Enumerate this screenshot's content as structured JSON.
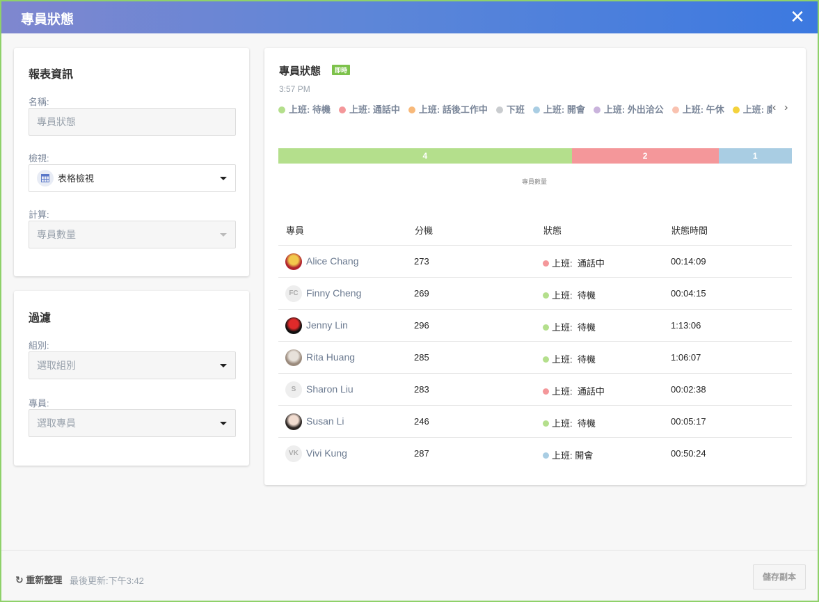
{
  "window": {
    "title": "專員狀態",
    "close_icon": "close-icon"
  },
  "left": {
    "report": {
      "title": "報表資訊",
      "name_label": "名稱:",
      "name_placeholder": "專員狀態",
      "view_label": "檢視:",
      "view_value": "表格檢視",
      "calc_label": "計算:",
      "calc_value": "專員數量"
    },
    "filter": {
      "title": "過濾",
      "group_label": "組別:",
      "group_placeholder": "選取組別",
      "agent_label": "專員:",
      "agent_placeholder": "選取專員"
    }
  },
  "main": {
    "title": "專員狀態",
    "badge": "即時",
    "time": "3:57 PM",
    "legend": [
      {
        "label": "上班: 待機",
        "color": "#b4df8c"
      },
      {
        "label": "上班: 通話中",
        "color": "#f4979a"
      },
      {
        "label": "上班: 話後工作中",
        "color": "#f8b97a"
      },
      {
        "label": "下班",
        "color": "#c9cccf"
      },
      {
        "label": "上班: 開會",
        "color": "#a9cde3"
      },
      {
        "label": "上班: 外出洽公",
        "color": "#c9b3dc"
      },
      {
        "label": "上班: 午休",
        "color": "#f9c2b0"
      },
      {
        "label": "上班: 廁所",
        "color": "#f4d23c"
      }
    ],
    "legend_prev": "‹",
    "legend_next": "›",
    "columns": [
      "專員",
      "分機",
      "狀態",
      "狀態時間"
    ],
    "rows": [
      {
        "name": "Alice Chang",
        "ext": "273",
        "status": "上班:  通話中",
        "status_color": "#f4979a",
        "time": "00:14:09",
        "avatar": "photo",
        "avatar_colors": [
          "#b0232d",
          "#f2c94c"
        ]
      },
      {
        "name": "Finny Cheng",
        "ext": "269",
        "status": "上班:  待機",
        "status_color": "#b4df8c",
        "time": "00:04:15",
        "avatar": "FC"
      },
      {
        "name": "Jenny Lin",
        "ext": "296",
        "status": "上班:  待機",
        "status_color": "#b4df8c",
        "time": "1:13:06",
        "avatar": "photo",
        "avatar_colors": [
          "#111111",
          "#e02a2a"
        ]
      },
      {
        "name": "Rita Huang",
        "ext": "285",
        "status": "上班:  待機",
        "status_color": "#b4df8c",
        "time": "1:06:07",
        "avatar": "photo",
        "avatar_colors": [
          "#9a8a7c",
          "#e7e1da"
        ]
      },
      {
        "name": "Sharon Liu",
        "ext": "283",
        "status": "上班:  通話中",
        "status_color": "#f4979a",
        "time": "00:02:38",
        "avatar": "S"
      },
      {
        "name": "Susan Li",
        "ext": "246",
        "status": "上班:  待機",
        "status_color": "#b4df8c",
        "time": "00:05:17",
        "avatar": "photo",
        "avatar_colors": [
          "#2b2523",
          "#f1dcd0"
        ]
      },
      {
        "name": "Vivi Kung",
        "ext": "287",
        "status": "上班: 開會",
        "status_color": "#a9cde3",
        "time": "00:50:24",
        "avatar": "VK"
      }
    ]
  },
  "chart_data": {
    "type": "bar",
    "orientation": "horizontal-stacked",
    "categories": [
      "上班: 待機",
      "上班: 通話中",
      "上班: 開會"
    ],
    "values": [
      4,
      2,
      1
    ],
    "colors": [
      "#b4df8c",
      "#f4979a",
      "#a9cde3"
    ],
    "xlabel": "專員數量"
  },
  "footer": {
    "refresh_label": "重新整理",
    "last_update": "最後更新:下午3:42",
    "save_copy": "儲存副本"
  }
}
